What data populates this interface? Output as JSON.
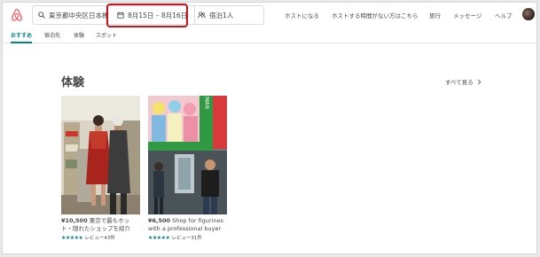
{
  "header": {
    "search": {
      "location": "東京都中央区日本橋",
      "dates": "8月15日 – 8月16日",
      "guests": "宿泊1人"
    },
    "nav": [
      "ホストになる",
      "ホストする時間がない方はこちら",
      "旅行",
      "メッセージ",
      "ヘルプ"
    ]
  },
  "tabs": [
    "おすすめ",
    "宿泊先",
    "体験",
    "スポット"
  ],
  "section": {
    "title": "体験",
    "see_all": "すべて見る"
  },
  "cards": [
    {
      "price": "¥10,500",
      "title": "東京で最もホット・隠れたショップを紹介",
      "stars": "★★★★★",
      "reviews": "レビュー43件"
    },
    {
      "price": "¥6,500",
      "title": "Shop for figurines with a professional buyer",
      "stars": "★★★★★",
      "reviews": "レビュー31件"
    }
  ],
  "colors": {
    "brand": "#ff5a5f",
    "accent": "#008489",
    "highlight": "#d01016"
  }
}
